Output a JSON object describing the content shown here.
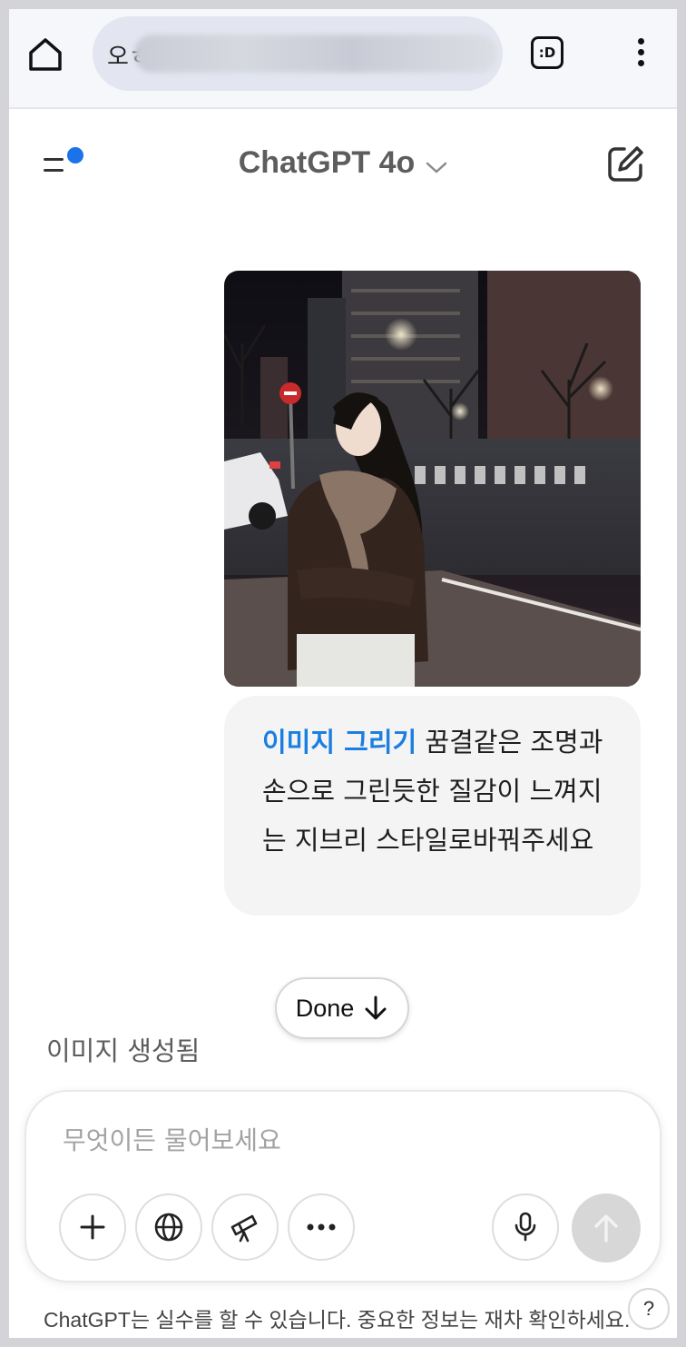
{
  "browser": {
    "tab_label": ":D",
    "url_prefix": "오ㅎ"
  },
  "header": {
    "model_title": "ChatGPT 4o",
    "has_notification": true
  },
  "message": {
    "image_alt": "Night street photo of a woman in a leather jacket and scarf",
    "tool_tag": "이미지 그리기",
    "prompt_text": " 꿈결같은 조명과 손으로 그린듯한 질감이 느껴지는 지브리 스타일로바꿔주세요"
  },
  "status": {
    "done_label": "Done",
    "generated_label": "이미지 생성됨"
  },
  "composer": {
    "placeholder": "무엇이든 물어보세요",
    "tools": [
      "plus-icon",
      "globe-icon",
      "telescope-icon",
      "more-icon"
    ]
  },
  "footer": {
    "disclaimer": "ChatGPT는 실수를 할 수 있습니다. 중요한 정보는 재차 확인하세요.",
    "help_label": "?"
  },
  "colors": {
    "accent": "#1a7fe0",
    "notification_dot": "#1a73e8",
    "bubble_bg": "#f4f4f4",
    "send_disabled": "#d7d7d7"
  }
}
